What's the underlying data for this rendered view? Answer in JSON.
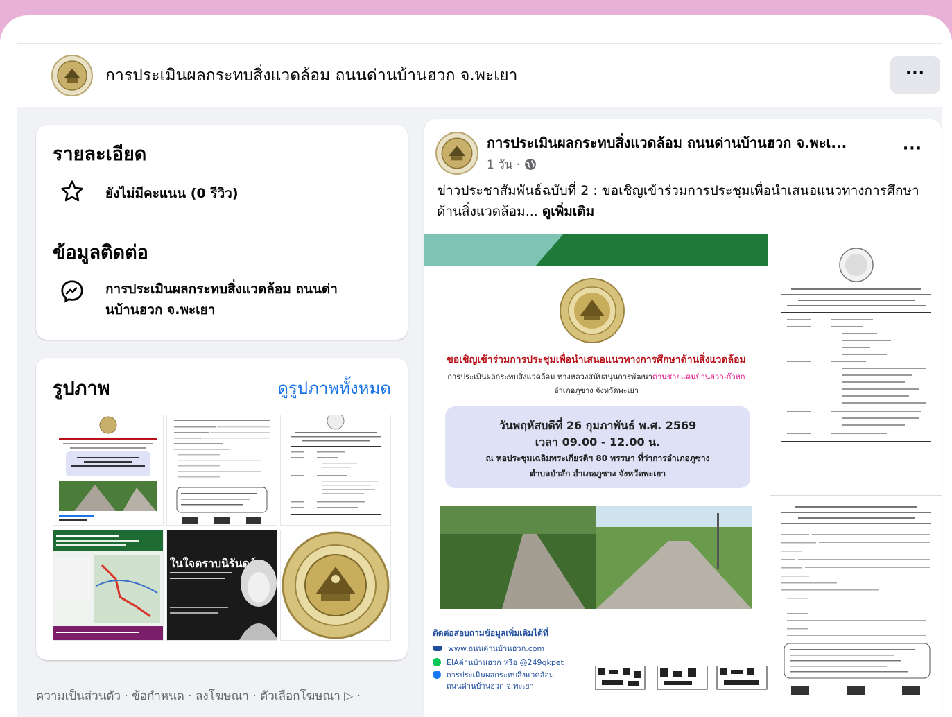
{
  "header": {
    "title": "การประเมินผลกระทบสิ่งแวดล้อม ถนนด่านบ้านฮวก จ.พะเยา",
    "more_label": "···"
  },
  "details": {
    "heading": "รายละเอียด",
    "rating_text": "ยังไม่มีคะแนน (0 รีวิว)",
    "contact_heading": "ข้อมูลติดต่อ",
    "messenger_line1": "การประเมินผลกระทบสิ่งแวดล้อม ถนนด่า",
    "messenger_line2": "นบ้านฮวก จ.พะเยา"
  },
  "photos": {
    "heading": "รูปภาพ",
    "see_all": "ดูรูปภาพทั้งหมด",
    "thumb5_title": "ในใจตราบนิรันดร์"
  },
  "footer": {
    "text": "ความเป็นส่วนตัว · ข้อกำหนด · ลงโฆษณา · ตัวเลือกโฆษณา ▷ ·"
  },
  "post": {
    "author": "การประเมินผลกระทบสิ่งแวดล้อม ถนนด่านบ้านฮวก จ.พะเ...",
    "meta": "1 วัน ·",
    "text": "ข่าวประชาสัมพันธ์ฉบับที่ 2 : ขอเชิญเข้าร่วมการประชุมเพื่อนำเสนอแนวทางการศึกษาด้านสิ่งแวดล้อม...",
    "see_more": "ดูเพิ่มเติม",
    "more_label": "···"
  },
  "flyer": {
    "headline": "ขอเชิญเข้าร่วมการประชุมเพื่อนำเสนอแนวทางการศึกษาด้านสิ่งแวดล้อม",
    "sub1_prefix": "การประเมินผลกระทบสิ่งแวดล้อม ทางหลวงสนับสนุนการพัฒนา",
    "sub1_highlight": "ด่านชายแดนบ้านฮวก-ก๊วหก",
    "sub2": "อำเภอภูซาง จังหวัดพะเยา",
    "date": "วันพฤหัสบดีที่ 26 กุมภาพันธ์ พ.ศ. 2569",
    "time": "เวลา 09.00 - 12.00 น.",
    "venue1": "ณ หอประชุมเฉลิมพระเกียรติฯ 80 พรรษา ที่ว่าการอำเภอภูซาง",
    "venue2": "ตำบลป่าสัก อำเภอภูซาง จังหวัดพะเยา",
    "contact_title": "ติดต่อสอบถามข้อมูลเพิ่มเติมได้ที่",
    "contact_web": "www.ถนนด่านบ้านฮวก.com",
    "contact_line": "EIAด่านบ้านฮวก หรือ @249qkpet",
    "contact_fb1": "การประเมินผลกระทบสิ่งแวดล้อม",
    "contact_fb2": "ถนนด่านบ้านฮวก จ.พะเยา"
  },
  "colors": {
    "accent_blue": "#1b74e4",
    "flyer_green": "#1f7a3a",
    "flyer_headline": "#b8121a",
    "flyer_highlight": "#e0198c",
    "page_bg": "#e8b2d7"
  }
}
